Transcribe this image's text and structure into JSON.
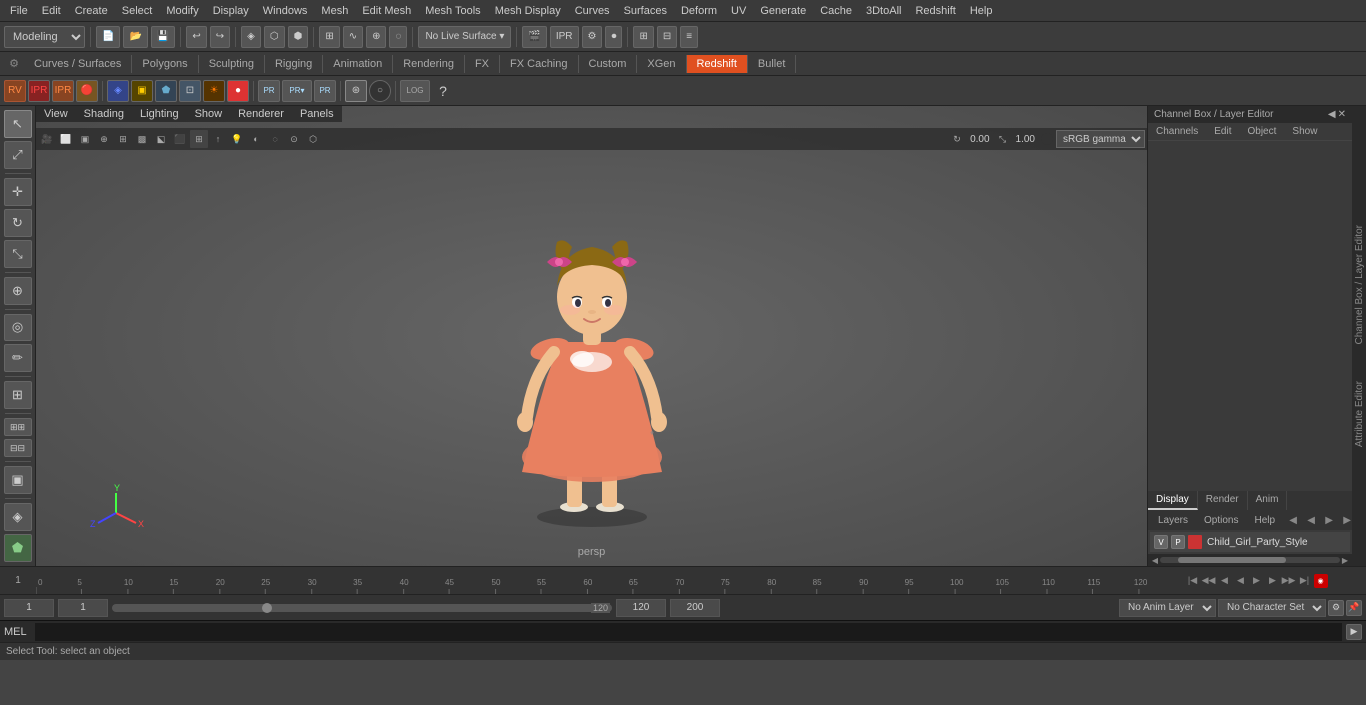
{
  "menubar": {
    "items": [
      "File",
      "Edit",
      "Create",
      "Select",
      "Modify",
      "Display",
      "Windows",
      "Mesh",
      "Edit Mesh",
      "Mesh Tools",
      "Mesh Display",
      "Curves",
      "Surfaces",
      "Deform",
      "UV",
      "Generate",
      "Cache",
      "3DtoAll",
      "Redshift",
      "Help"
    ]
  },
  "toolbar1": {
    "modeling_label": "Modeling",
    "toolbar_sep": "|"
  },
  "tabbar": {
    "tabs": [
      {
        "label": "Curves / Surfaces",
        "active": false
      },
      {
        "label": "Polygons",
        "active": false
      },
      {
        "label": "Sculpting",
        "active": false
      },
      {
        "label": "Rigging",
        "active": false
      },
      {
        "label": "Animation",
        "active": false
      },
      {
        "label": "Rendering",
        "active": false
      },
      {
        "label": "FX",
        "active": false
      },
      {
        "label": "FX Caching",
        "active": false
      },
      {
        "label": "Custom",
        "active": false
      },
      {
        "label": "XGen",
        "active": false
      },
      {
        "label": "Redshift",
        "active": true
      },
      {
        "label": "Bullet",
        "active": false
      }
    ]
  },
  "viewport": {
    "menus": [
      "View",
      "Shading",
      "Lighting",
      "Show",
      "Renderer",
      "Panels"
    ],
    "label": "persp",
    "gamma": "sRGB gamma",
    "rotation_val": "0.00",
    "scale_val": "1.00"
  },
  "rightpanel": {
    "title": "Channel Box / Layer Editor",
    "tabs": [
      "Channels",
      "Edit",
      "Object",
      "Show"
    ],
    "display_tabs": [
      "Display",
      "Render",
      "Anim"
    ],
    "layer_tabs": [
      "Layers",
      "Options",
      "Help"
    ],
    "layer_row": {
      "v": "V",
      "p": "P",
      "color": "#cc3333",
      "name": "Child_Girl_Party_Style"
    }
  },
  "righttabs": {
    "items": [
      "Channel Box / Layer Editor",
      "Attribute Editor"
    ]
  },
  "timeline": {
    "ticks": [
      0,
      5,
      10,
      15,
      20,
      25,
      30,
      35,
      40,
      45,
      50,
      55,
      60,
      65,
      70,
      75,
      80,
      85,
      90,
      95,
      100,
      105,
      110,
      115,
      120
    ],
    "current_frame": "1"
  },
  "statusbar": {
    "frame_start": "1",
    "frame_current": "1",
    "slider_current": "1",
    "frame_end_slider": "120",
    "frame_end": "120",
    "range_end": "200",
    "anim_layer": "No Anim Layer",
    "character_set": "No Character Set"
  },
  "melbar": {
    "prefix": "MEL",
    "placeholder": ""
  },
  "bottomstatus": {
    "text": "Select Tool: select an object"
  },
  "transport": {
    "buttons": [
      "|◀",
      "◀◀",
      "◀",
      "◀",
      "▶",
      "▶▶",
      "▶|",
      "||"
    ]
  }
}
